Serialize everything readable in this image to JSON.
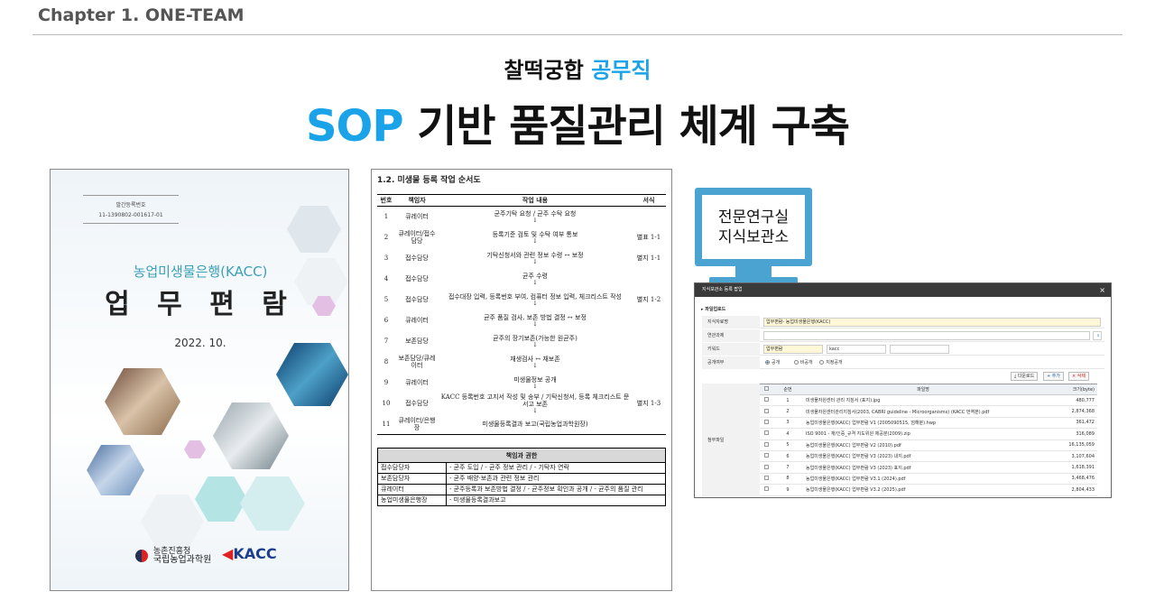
{
  "header": {
    "chapter": "Chapter 1. ONE-TEAM",
    "subtitle_main": "찰떡궁합",
    "subtitle_accent": "공무직",
    "title_accent": "SOP",
    "title_main": "기반 품질관리 체계 구축"
  },
  "cover": {
    "reg_label": "발간등록번호",
    "reg_no": "11-1390802-001617-01",
    "org": "농업미생물은행(KACC)",
    "book_title": "업 무 편 람",
    "date": "2022. 10.",
    "logo_line1": "농촌진흥청",
    "logo_line2": "국립농업과학원",
    "kacc_logo": "KACC"
  },
  "document": {
    "title": "1.2. 미생물 등록 작업 순서도",
    "headers": [
      "번호",
      "책임자",
      "작업 내용",
      "서식"
    ],
    "arrow": "↓",
    "rows": [
      {
        "no": "1",
        "who": "큐레이터",
        "task": "균주기탁 요청 / 균주 수탁 요청",
        "form": ""
      },
      {
        "no": "2",
        "who": "큐레이터/접수담당",
        "task": "등록기준 검토 및 수탁 여부 통보",
        "form": "별표 1-1"
      },
      {
        "no": "3",
        "who": "접수담당",
        "task": "기탁신청서와 관련 정보 수령 ↔ 보정",
        "form": "별지 1-1"
      },
      {
        "no": "4",
        "who": "접수담당",
        "task": "균주 수령",
        "form": ""
      },
      {
        "no": "5",
        "who": "접수담당",
        "task": "접수대장 입력, 등록번호 부여, 컴퓨터 정보 입력, 체크리스트 작성",
        "form": "별지 1-2"
      },
      {
        "no": "6",
        "who": "큐레이터",
        "task": "균주 품질 검사, 보존 방법 결정 ↔ 보정",
        "form": ""
      },
      {
        "no": "7",
        "who": "보존담당",
        "task": "균주의 장기보존(가능한 원균주)",
        "form": ""
      },
      {
        "no": "8",
        "who": "보존담당/큐레이터",
        "task": "재생검사 ↔ 재보존",
        "form": ""
      },
      {
        "no": "9",
        "who": "큐레이터",
        "task": "미생물정보 공개",
        "form": ""
      },
      {
        "no": "10",
        "who": "접수담당",
        "task": "KACC 등록번호 고지서 작성 및 송부 / 기탁신청서, 등록 체크리스트 문서고 보존",
        "form": "별지 1-3"
      },
      {
        "no": "11",
        "who": "큐레이터/은행장",
        "task": "미생물등록결과 보고(국립농업과학원장)",
        "form": ""
      }
    ],
    "roles_header": "책임과 권한",
    "roles": [
      {
        "who": "접수담당자",
        "duties": "- 균주 도입 / - 균주 정보 관리 / - 기탁자 연락"
      },
      {
        "who": "보존담당자",
        "duties": "- 균주 배양·보존과 관련 정보 관리"
      },
      {
        "who": "큐레이터",
        "duties": "- 균주등록과 보존방법 결정 / - 균주정보 확인과 공개 / - 균주의 품질 관리"
      },
      {
        "who": "농업미생물은행장",
        "duties": "- 미생물등록결과보고"
      }
    ]
  },
  "monitor": {
    "line1": "전문연구실",
    "line2": "지식보관소"
  },
  "popup": {
    "title": "지식보관소 등록 팝업",
    "close": "×",
    "section": "▸ 파일업로드",
    "fields": {
      "material_label": "지식자료명",
      "material_value": "업무편람- 농업미생물은행(KACC)",
      "task_label": "연관과제",
      "keyword_label": "키워드",
      "keyword1": "업무편람",
      "keyword2": "kacc",
      "public_label": "공개여부",
      "opt_public": "공개",
      "opt_private": "비공개",
      "opt_target": "지정공개",
      "attach_label": "첨부파일"
    },
    "buttons": {
      "download": "다운로드",
      "add": "추가",
      "delete": "삭제"
    },
    "table_headers": [
      "순번",
      "파일명",
      "크기(byte)"
    ],
    "files": [
      {
        "no": "1",
        "name": "미생물자원센터 관리 지침서 (표지).jpg",
        "size": "480,777"
      },
      {
        "no": "2",
        "name": "미생물자원센터관리지침서(2003, CABRI guideline - Microorganisms) (KACC 번역본).pdf",
        "size": "2,874,368"
      },
      {
        "no": "3",
        "name": "농업미생물은행(KACC) 업무편람 V1 (2005090515, 엄해분).hwp",
        "size": "361,472"
      },
      {
        "no": "4",
        "name": "ISO 9001 - 재/인증_규격 지도위원 제공분(2009).zip",
        "size": "316,089"
      },
      {
        "no": "5",
        "name": "농업미생물은행(KACC) 업무편람 V2 (2010).pdf",
        "size": "16,135,059"
      },
      {
        "no": "6",
        "name": "농업미생물은행(KACC) 업무편람 V3 (2023) 내지.pdf",
        "size": "3,107,604"
      },
      {
        "no": "7",
        "name": "농업미생물은행(KACC) 업무편람 V3 (2023) 표지.pdf",
        "size": "1,618,391"
      },
      {
        "no": "8",
        "name": "농업미생물은행(KACC) 업무편람 V3.1 (2024).pdf",
        "size": "3,468,476"
      },
      {
        "no": "9",
        "name": "농업미생물은행(KACC) 업무편람 V3.2 (2025).pdf",
        "size": "2,804,433"
      }
    ]
  }
}
